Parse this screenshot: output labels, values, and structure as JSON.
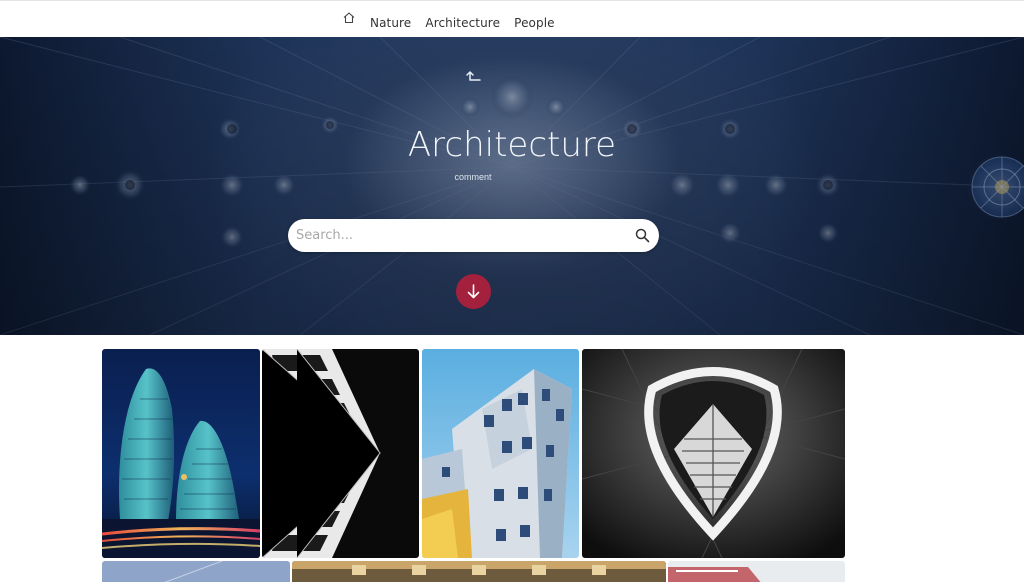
{
  "nav": {
    "home_icon": "home-icon",
    "links": [
      "Nature",
      "Architecture",
      "People"
    ]
  },
  "hero": {
    "up_icon": "arrow-up-corner-icon",
    "title": "Architecture",
    "subtitle": "comment",
    "search_placeholder": "Search...",
    "search_icon": "search-icon",
    "scroll_icon": "arrow-down-icon",
    "accent_color": "#a3213d"
  },
  "gallery": {
    "photos": [
      "twin-curved-towers-at-night",
      "white-building-facade-perspective",
      "deconstructed-building-blue-sky",
      "tower-framed-in-arch",
      "sky-photo",
      "interior-ceiling-photo",
      "white-building-photo"
    ]
  }
}
